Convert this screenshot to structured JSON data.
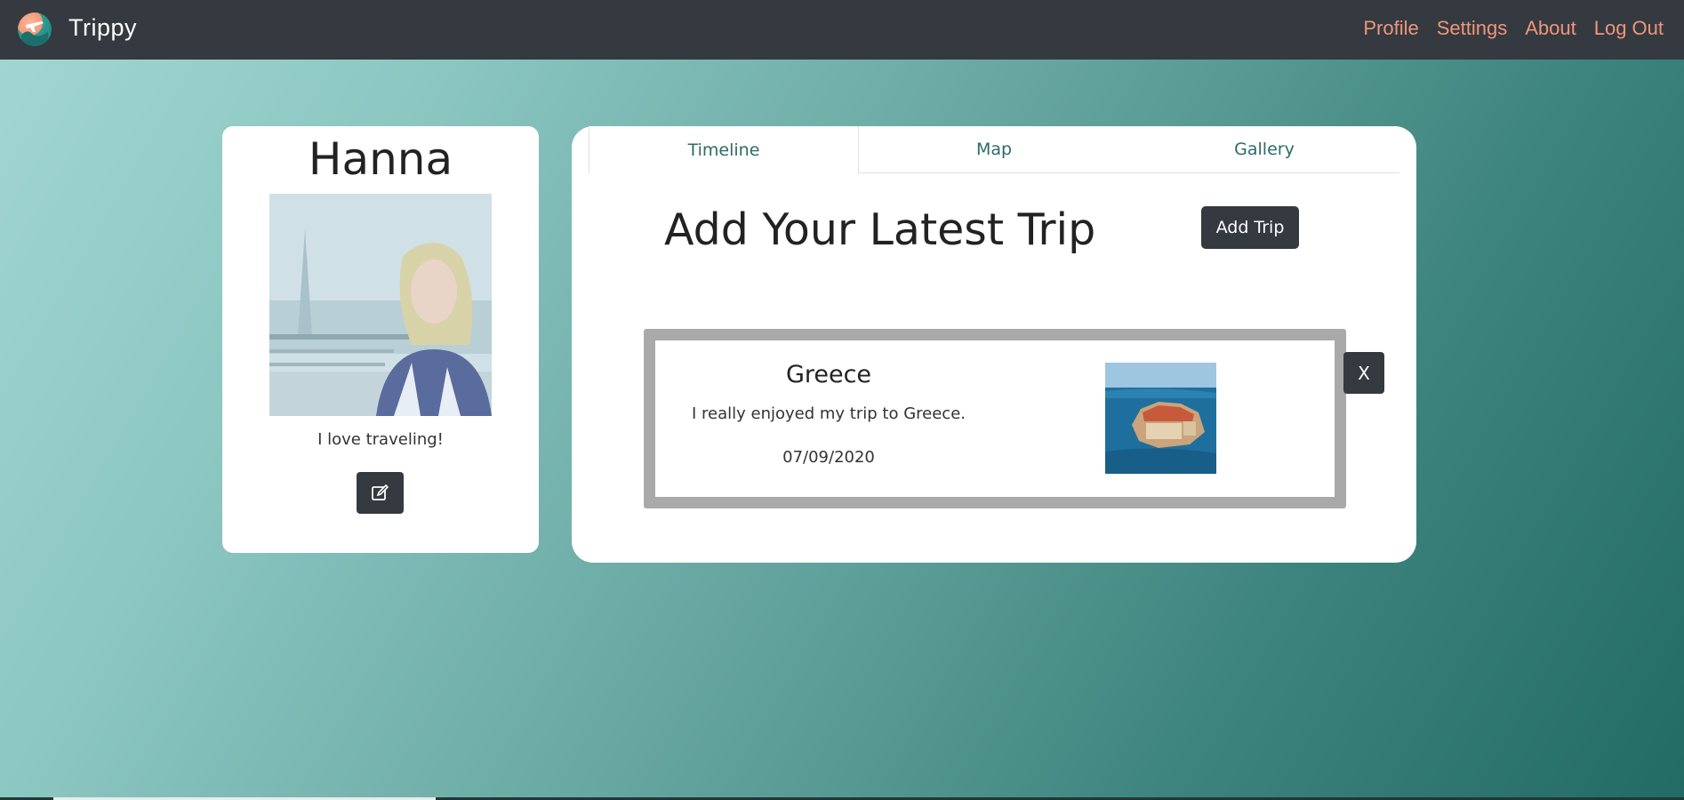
{
  "app": {
    "brand": "Trippy",
    "logo_icon": "airplane-globe-logo-icon"
  },
  "nav": {
    "links": [
      "Profile",
      "Settings",
      "About",
      "Log Out"
    ],
    "link_color": "#f1957a",
    "background": "#343a40"
  },
  "profile": {
    "name": "Hanna",
    "bio": "I love traveling!",
    "edit_icon": "edit-icon"
  },
  "tabs": [
    {
      "label": "Timeline",
      "active": true
    },
    {
      "label": "Map",
      "active": false
    },
    {
      "label": "Gallery",
      "active": false
    }
  ],
  "main": {
    "title": "Add Your Latest Trip",
    "add_button": "Add Trip"
  },
  "trip": {
    "title": "Greece",
    "description": "I really enjoyed my trip to Greece.",
    "date": "07/09/2020",
    "close_label": "X"
  }
}
